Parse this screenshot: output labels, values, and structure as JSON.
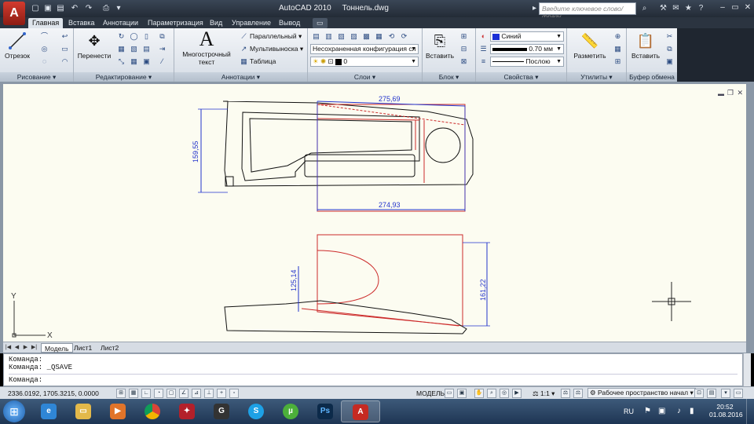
{
  "titlebar": {
    "app_name": "AutoCAD 2010",
    "file_name": "Тоннель.dwg",
    "search_placeholder": "Введите ключевое слово/фразу"
  },
  "ribbon_tabs": [
    "Главная",
    "Вставка",
    "Аннотации",
    "Параметризация",
    "Вид",
    "Управление",
    "Вывод"
  ],
  "ribbon": {
    "draw": {
      "title": "Рисование",
      "line_label": "Отрезок"
    },
    "modify": {
      "title": "Редактирование",
      "move_label": "Перенести"
    },
    "annotation": {
      "title": "Аннотации",
      "mtext_label_1": "Многострочный",
      "mtext_label_2": "текст",
      "dim_label": "Параллельный",
      "mleader_label": "Мультивыноска",
      "table_label": "Таблица"
    },
    "layers": {
      "title": "Слои",
      "layer_state": "Несохраненная конфигурация сл",
      "current_layer": "0"
    },
    "block": {
      "title": "Блок",
      "insert_label": "Вставить"
    },
    "properties": {
      "title": "Свойства",
      "color": "Синий",
      "lineweight": "0.70 мм",
      "linetype": "Послою"
    },
    "utilities": {
      "title": "Утилиты",
      "measure_label": "Разметить"
    },
    "clipboard": {
      "title": "Буфер обмена",
      "paste_label": "Вставить"
    }
  },
  "drawing": {
    "ucs_x": "X",
    "ucs_y": "Y",
    "dims": {
      "top_width": "275,69",
      "bottom_width": "274,93",
      "left_height": "159,55",
      "lower_left_height": "125,14",
      "lower_right_height": "161,22"
    }
  },
  "layout_tabs": [
    "Модель",
    "Лист1",
    "Лист2"
  ],
  "command_lines": [
    "Команда:",
    "Команда:  _QSAVE",
    "Команда:"
  ],
  "statusbar": {
    "coords": "2336.0192, 1705.3215, 0.0000",
    "model_label": "МОДЕЛЬ",
    "scale": "1:1",
    "workspace": "Рабочее пространство начал"
  },
  "tray": {
    "lang": "RU",
    "time": "20:52",
    "date": "01.08.2016"
  },
  "colors": {
    "accent_red": "#cc2a2a",
    "dim_blue": "#2233cc",
    "canvas_bg": "#fcfcf1"
  }
}
